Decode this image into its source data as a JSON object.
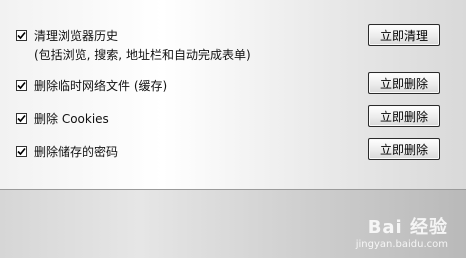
{
  "options": [
    {
      "label": "清理浏览器历史",
      "checked": true,
      "button": "立即清理"
    },
    {
      "label": "删除临时网络文件 (缓存)",
      "checked": true,
      "button": "立即删除"
    },
    {
      "label": "删除 Cookies",
      "checked": true,
      "button": "立即删除"
    },
    {
      "label": "删除储存的密码",
      "checked": true,
      "button": "立即删除"
    }
  ],
  "history_description": "(包括浏览, 搜索, 地址栏和自动完成表单)",
  "watermark": {
    "brand": "Bai 经验",
    "url": "jingyan.baidu.com"
  }
}
